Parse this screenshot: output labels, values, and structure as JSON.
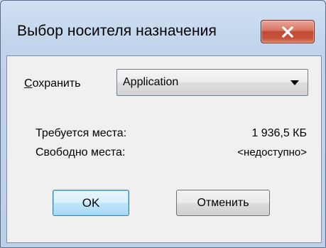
{
  "window": {
    "title": "Выбор носителя назначения"
  },
  "form": {
    "save_label_accel": "С",
    "save_label_rest": "охранить",
    "destination_value": "Application",
    "required_label": "Требуется места:",
    "required_value": "1 936,5 КБ",
    "free_label": "Свободно места:",
    "free_value": "<недоступно>"
  },
  "buttons": {
    "ok": "OK",
    "cancel": "Отменить"
  },
  "icons": {
    "close": "close-icon",
    "dropdown": "chevron-down-icon"
  },
  "colors": {
    "close_button": "#c7533c",
    "default_button_border": "#3c7fb1"
  }
}
